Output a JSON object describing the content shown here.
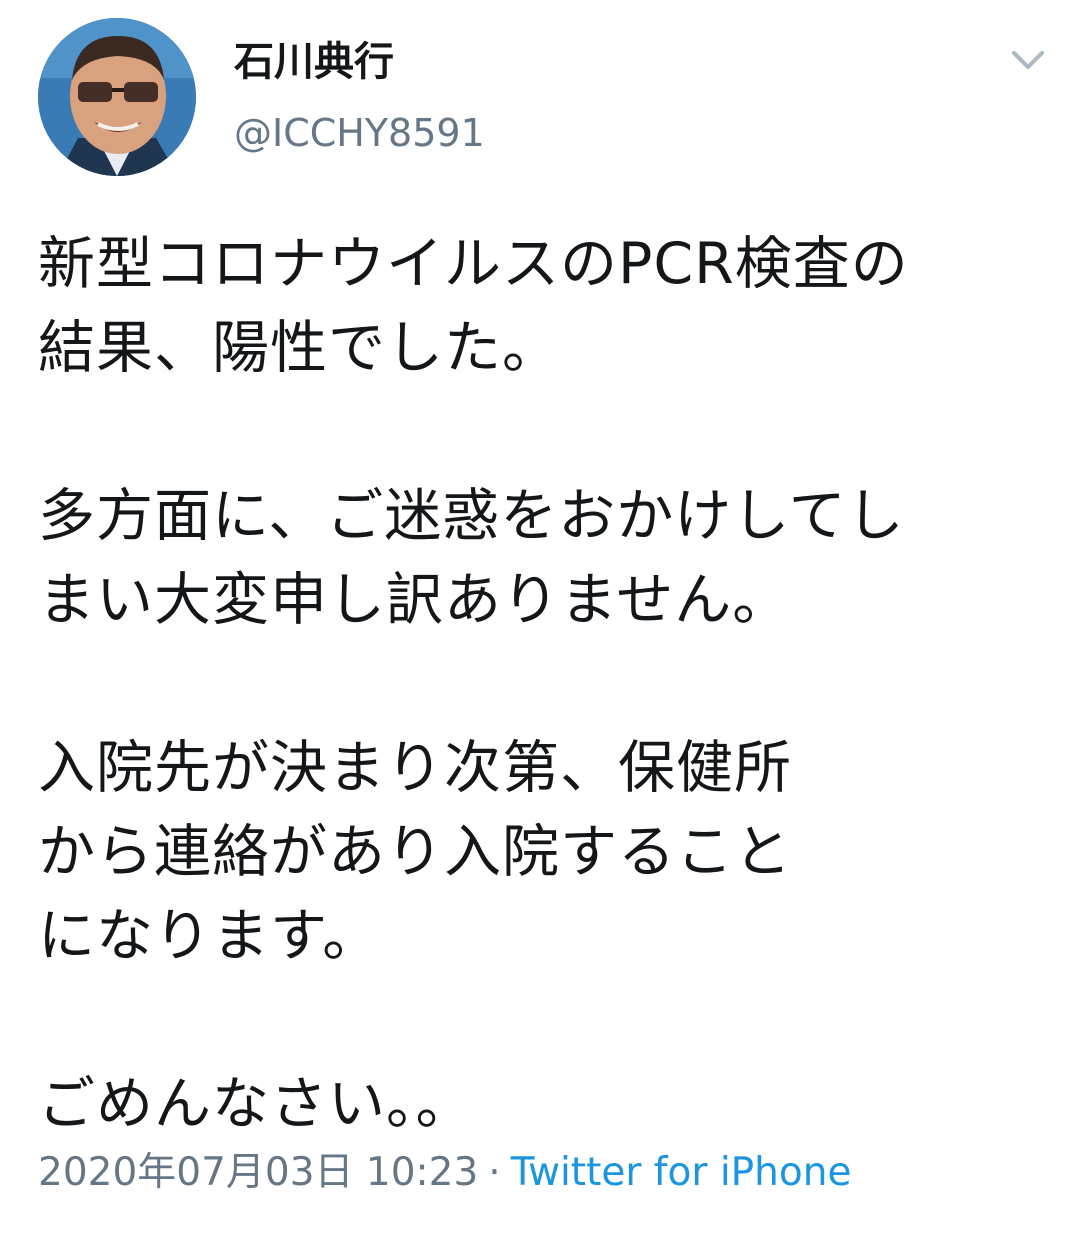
{
  "tweet": {
    "author": {
      "display_name": "石川典行",
      "handle": "@ICCHY8591",
      "avatar_icon": "user-avatar-photo"
    },
    "more_icon": "chevron-down-icon",
    "text": "新型コロナウイルスのPCR検査の\n結果、陽性でした。\n\n多方面に、ご迷惑をおかけしてし\nまい大変申し訳ありません。\n\n入院先が決まり次第、保健所\nから連絡があり入院すること\nになります。\n\nごめんなさい。。",
    "timestamp": "2020年07月03日 10:23",
    "separator": "·",
    "source": "Twitter for iPhone"
  },
  "colors": {
    "text": "#14171a",
    "secondary": "#657786",
    "link": "#1b95e0",
    "chevron": "#aab8c2"
  }
}
